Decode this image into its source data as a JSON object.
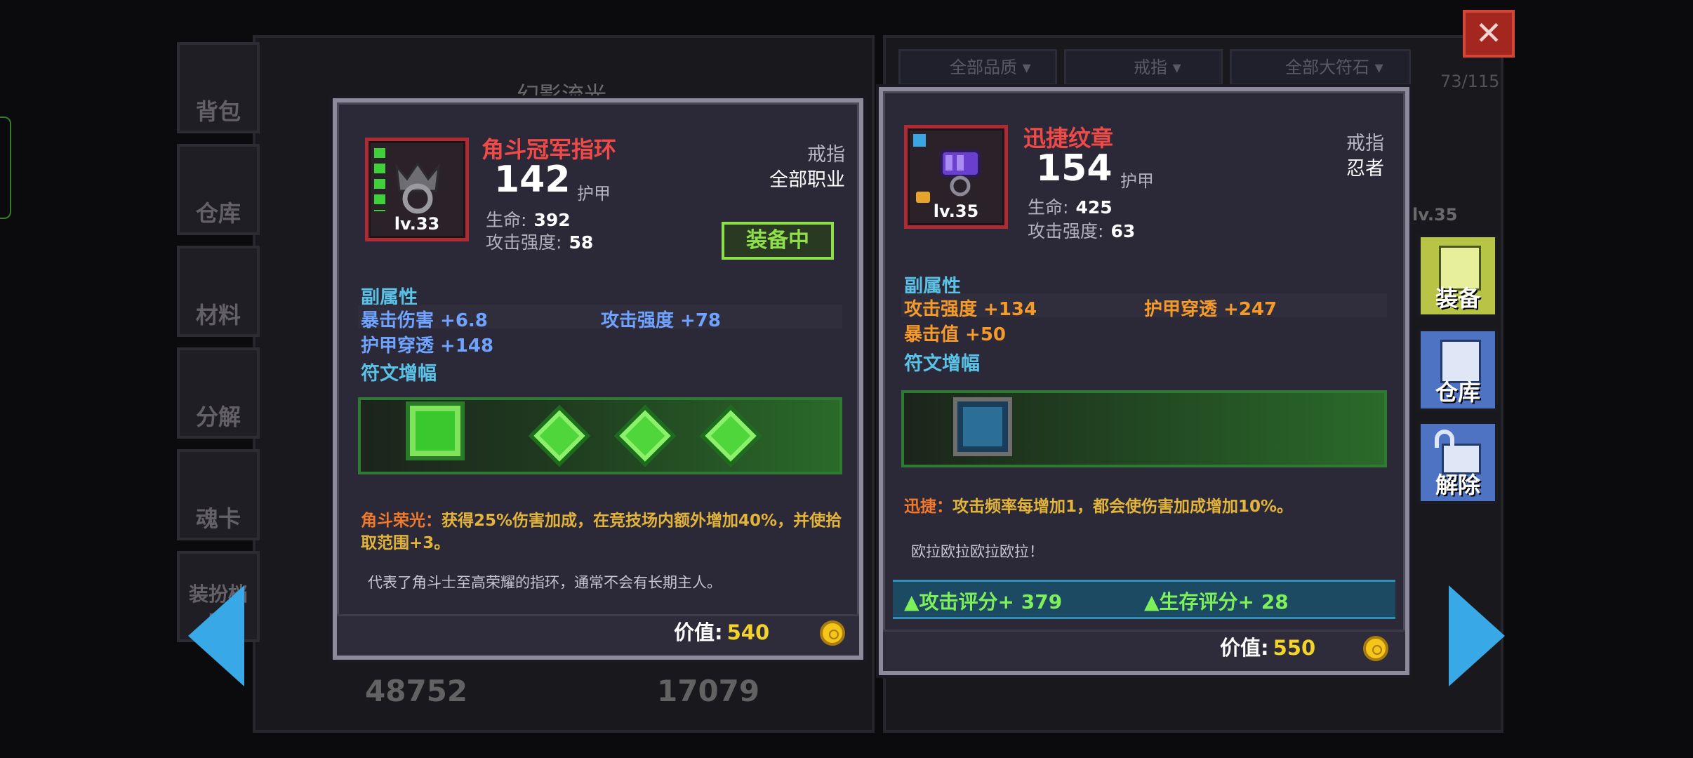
{
  "background": {
    "left_tabs": [
      {
        "label": "背包"
      },
      {
        "label": "仓库"
      },
      {
        "label": "材料"
      },
      {
        "label": "分解"
      },
      {
        "label": "魂卡"
      },
      {
        "label": "装扮档案"
      }
    ],
    "bg_title": "幻影流光",
    "bg_stats": [
      "48752",
      "17079"
    ],
    "filters": [
      {
        "label": "全部品质"
      },
      {
        "label": "戒指"
      },
      {
        "label": "全部大符石"
      }
    ],
    "capacity": "73/115"
  },
  "close_label": "✕",
  "left_item": {
    "name": "角斗冠军指环",
    "level": "lv.33",
    "armor": "142",
    "armor_label": "护甲",
    "hp_label": "生命:",
    "hp": "392",
    "atk_label": "攻击强度:",
    "atk": "58",
    "type": "戒指",
    "job": "全部职业",
    "status": "装备中",
    "sub_title": "副属性",
    "sub_stats": [
      "暴击伤害 +6.8",
      "攻击强度 +78",
      "护甲穿透 +148"
    ],
    "rune_title": "符文增幅",
    "effect_name": "角斗荣光：",
    "effect_text": "获得25%伤害加成，在竞技场内额外增加40%，并使拾取范围+3。",
    "flavor": "代表了角斗士至高荣耀的指环，通常不会有长期主人。",
    "value_label": "价值:",
    "value": "540"
  },
  "right_item": {
    "name": "迅捷纹章",
    "level": "lv.35",
    "armor": "154",
    "armor_label": "护甲",
    "hp_label": "生命:",
    "hp": "425",
    "atk_label": "攻击强度:",
    "atk": "63",
    "type": "戒指",
    "job": "忍者",
    "sub_title": "副属性",
    "sub_stats": [
      "攻击强度 +134",
      "护甲穿透 +247",
      "暴击值 +50"
    ],
    "rune_title": "符文增幅",
    "effect_name": "迅捷：",
    "effect_text": "攻击频率每增加1，都会使伤害加成增加10%。",
    "flavor": "欧拉欧拉欧拉欧拉！",
    "score_attack": "▲攻击评分+ 379",
    "score_survive": "▲生存评分+ 28",
    "value_label": "价值:",
    "value": "550"
  },
  "side_buttons": [
    {
      "label": "装备"
    },
    {
      "label": "仓库"
    },
    {
      "label": "解除"
    }
  ],
  "bg_item_level": "lv.35",
  "colors": {
    "legendary_red": "#f04a48",
    "sub_blue": "#6fa3ff",
    "sub_orange": "#f59a2a",
    "section_cyan": "#59c2e6",
    "value_gold": "#f4d42a",
    "equipped_green": "#8ee04a"
  }
}
